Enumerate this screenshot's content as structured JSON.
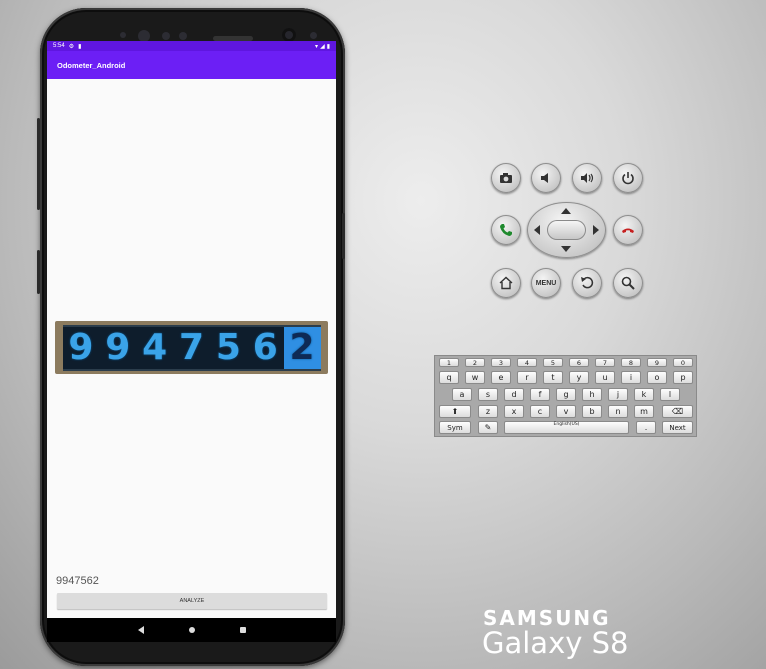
{
  "status_bar": {
    "time": "5:54"
  },
  "app": {
    "title": "Odometer_Android"
  },
  "odometer_image": {
    "digits": [
      "9",
      "9",
      "4",
      "7",
      "5",
      "6",
      "2"
    ]
  },
  "result_text": "9947562",
  "analyze_button": {
    "label": "ANALYZE"
  },
  "nav_icons": [
    "back-icon",
    "home-icon",
    "recents-icon"
  ],
  "controls": {
    "menu_label": "MENU",
    "buttons": [
      "camera-icon",
      "volume-down-icon",
      "volume-up-icon",
      "power-icon",
      "call-icon",
      "dpad",
      "end-call-icon",
      "home-icon",
      "menu",
      "back-icon",
      "search-icon"
    ]
  },
  "keyboard": {
    "row_numbers": [
      "1",
      "2",
      "3",
      "4",
      "5",
      "6",
      "7",
      "8",
      "9",
      "0"
    ],
    "row1": [
      "q",
      "w",
      "e",
      "r",
      "t",
      "y",
      "u",
      "i",
      "o",
      "p"
    ],
    "row2": [
      "a",
      "s",
      "d",
      "f",
      "g",
      "h",
      "j",
      "k",
      "l"
    ],
    "row3": [
      "z",
      "x",
      "c",
      "v",
      "b",
      "n",
      "m"
    ],
    "sym_label": "Sym",
    "space_label": "English(US)",
    "period_label": ".",
    "next_label": "Next"
  },
  "branding": {
    "maker": "SAMSUNG",
    "model": "Galaxy S8"
  },
  "colors": {
    "status_bar": "#5f16e0",
    "app_bar": "#6c1ff5",
    "odometer_digits": "#3aa3e8"
  }
}
